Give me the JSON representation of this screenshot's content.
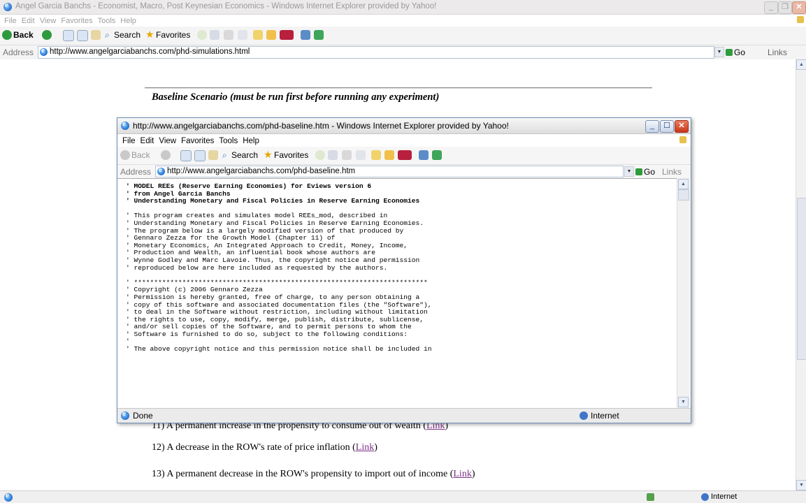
{
  "outer_window": {
    "title": "Angel Garcia Banchs - Economist, Macro, Post Keynesian Economics - Windows Internet Explorer provided by Yahoo!",
    "menu": [
      "File",
      "Edit",
      "View",
      "Favorites",
      "Tools",
      "Help"
    ],
    "toolbar": {
      "back": "Back",
      "search": "Search",
      "favorites": "Favorites"
    },
    "address_label": "Address",
    "url": "http://www.angelgarciabanchs.com/phd-simulations.html",
    "go": "Go",
    "links": "Links",
    "page": {
      "baseline_heading": "Baseline Scenario (must be run first before running any experiment)",
      "experiments": [
        {
          "text": "11) A permanent increase in the propensity to consume out of wealth",
          "link": "Link"
        },
        {
          "text": "12) A decrease in the ROW's rate of price inflation",
          "link": "Link"
        },
        {
          "text": "13) A permanent decrease in the ROW's propensity to import out of income",
          "link": "Link"
        }
      ]
    },
    "status_zone": "Internet"
  },
  "popup_window": {
    "title": "http://www.angelgarciabanchs.com/phd-baseline.htm - Windows Internet Explorer provided by Yahoo!",
    "menu": [
      "File",
      "Edit",
      "View",
      "Favorites",
      "Tools",
      "Help"
    ],
    "toolbar": {
      "back": "Back",
      "search": "Search",
      "favorites": "Favorites"
    },
    "address_label": "Address",
    "url": "http://www.angelgarciabanchs.com/phd-baseline.htm",
    "go": "Go",
    "links": "Links",
    "code_bold": [
      "' MODEL REEs (Reserve Earning Economies) for Eviews version 6",
      "' from Angel Garcia Banchs",
      "' Understanding Monetary and Fiscal Policies in Reserve Earning Economies"
    ],
    "code_normal": [
      "' This program creates and simulates model REEs_mod, described in",
      "' Understanding Monetary and Fiscal Policies in Reserve Earning Economies.",
      "' The program below is a largely modified version of that produced by",
      "' Gennaro Zezza for the Growth Model (Chapter 11) of",
      "' Monetary Economics, An Integrated Approach to Credit, Money, Income,",
      "' Production and Wealth, an influential book whose authors are",
      "' Wynne Godley and Marc Lavoie. Thus, the copyright notice and permission",
      "' reproduced below are here included as requested by the authors.",
      "",
      "' *************************************************************************",
      "' Copyright (c) 2006 Gennaro Zezza",
      "' Permission is hereby granted, free of charge, to any person obtaining a",
      "' copy of this software and associated documentation files (the \"Software\"),",
      "' to deal in the Software without restriction, including without limitation",
      "' the rights to use, copy, modify, merge, publish, distribute, sublicense,",
      "' and/or sell copies of the Software, and to permit persons to whom the",
      "' Software is furnished to do so, subject to the following conditions:",
      "'",
      "' The above copyright notice and this permission notice shall be included in"
    ],
    "status_left": "Done",
    "status_zone": "Internet"
  }
}
